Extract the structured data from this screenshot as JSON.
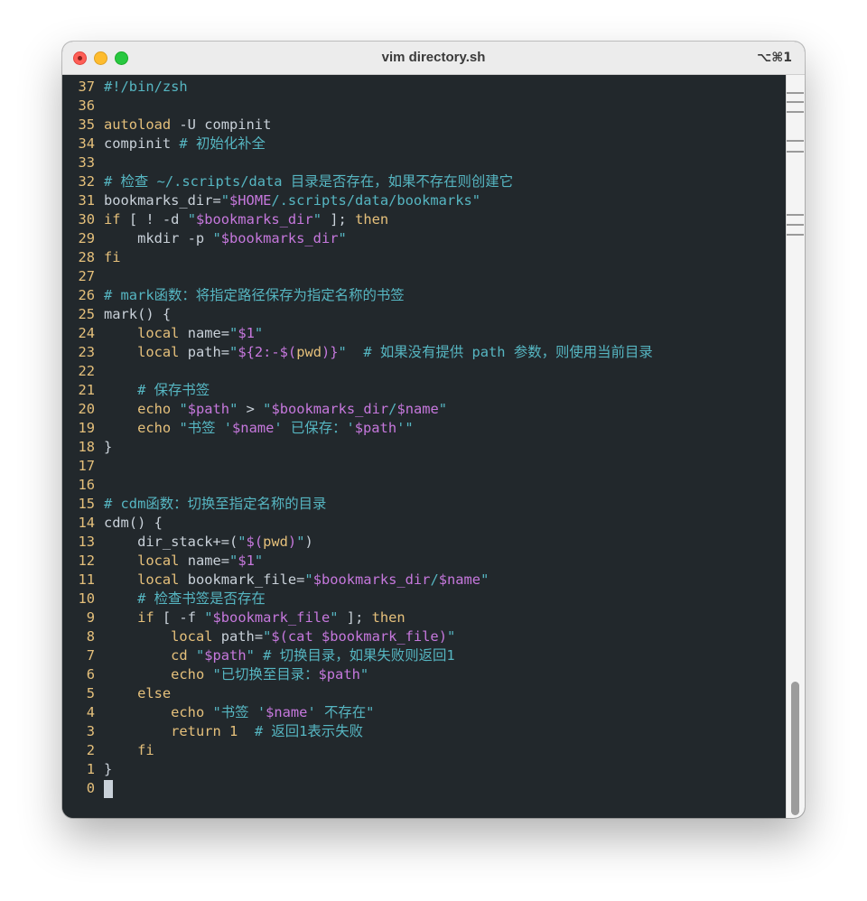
{
  "window": {
    "title": "vim directory.sh",
    "shortcut": "⌥⌘1"
  },
  "editor": {
    "lines": [
      {
        "n": "37",
        "t": [
          {
            "s": "#!/bin/zsh",
            "c": "cm"
          }
        ]
      },
      {
        "n": "36",
        "t": []
      },
      {
        "n": "35",
        "t": [
          {
            "s": "autoload",
            "c": "kw"
          },
          {
            "s": " -U compinit",
            "c": ""
          }
        ]
      },
      {
        "n": "34",
        "t": [
          {
            "s": "compinit ",
            "c": ""
          },
          {
            "s": "# 初始化补全",
            "c": "cm"
          }
        ]
      },
      {
        "n": "33",
        "t": []
      },
      {
        "n": "32",
        "t": [
          {
            "s": "# 检查 ~/.scripts/data 目录是否存在，如果不存在则创建它",
            "c": "cm"
          }
        ]
      },
      {
        "n": "31",
        "t": [
          {
            "s": "bookmarks_dir=",
            "c": ""
          },
          {
            "s": "\"",
            "c": "st"
          },
          {
            "s": "$HOME",
            "c": "vr"
          },
          {
            "s": "/.scripts/data/bookmarks\"",
            "c": "st"
          }
        ]
      },
      {
        "n": "30",
        "t": [
          {
            "s": "if",
            "c": "kw"
          },
          {
            "s": " [ ! -d ",
            "c": ""
          },
          {
            "s": "\"",
            "c": "st"
          },
          {
            "s": "$bookmarks_dir",
            "c": "vr"
          },
          {
            "s": "\"",
            "c": "st"
          },
          {
            "s": " ]; ",
            "c": ""
          },
          {
            "s": "then",
            "c": "kw"
          }
        ]
      },
      {
        "n": "29",
        "t": [
          {
            "s": "    mkdir -p ",
            "c": ""
          },
          {
            "s": "\"",
            "c": "st"
          },
          {
            "s": "$bookmarks_dir",
            "c": "vr"
          },
          {
            "s": "\"",
            "c": "st"
          }
        ]
      },
      {
        "n": "28",
        "t": [
          {
            "s": "fi",
            "c": "kw"
          }
        ]
      },
      {
        "n": "27",
        "t": []
      },
      {
        "n": "26",
        "t": [
          {
            "s": "# mark函数：将指定路径保存为指定名称的书签",
            "c": "cm"
          }
        ]
      },
      {
        "n": "25",
        "t": [
          {
            "s": "mark() {",
            "c": ""
          }
        ]
      },
      {
        "n": "24",
        "t": [
          {
            "s": "    ",
            "c": ""
          },
          {
            "s": "local",
            "c": "kw"
          },
          {
            "s": " name=",
            "c": ""
          },
          {
            "s": "\"",
            "c": "st"
          },
          {
            "s": "$1",
            "c": "vr"
          },
          {
            "s": "\"",
            "c": "st"
          }
        ]
      },
      {
        "n": "23",
        "t": [
          {
            "s": "    ",
            "c": ""
          },
          {
            "s": "local",
            "c": "kw"
          },
          {
            "s": " path=",
            "c": ""
          },
          {
            "s": "\"",
            "c": "st"
          },
          {
            "s": "${2:-$(",
            "c": "vr"
          },
          {
            "s": "pwd",
            "c": "cmd"
          },
          {
            "s": ")}",
            "c": "vr"
          },
          {
            "s": "\"",
            "c": "st"
          },
          {
            "s": "  # 如果没有提供 path 参数，则使用当前目录",
            "c": "cm"
          }
        ]
      },
      {
        "n": "22",
        "t": []
      },
      {
        "n": "21",
        "t": [
          {
            "s": "    # 保存书签",
            "c": "cm"
          }
        ]
      },
      {
        "n": "20",
        "t": [
          {
            "s": "    ",
            "c": ""
          },
          {
            "s": "echo",
            "c": "kw"
          },
          {
            "s": " ",
            "c": ""
          },
          {
            "s": "\"",
            "c": "st"
          },
          {
            "s": "$path",
            "c": "vr"
          },
          {
            "s": "\"",
            "c": "st"
          },
          {
            "s": " > ",
            "c": ""
          },
          {
            "s": "\"",
            "c": "st"
          },
          {
            "s": "$bookmarks_dir",
            "c": "vr"
          },
          {
            "s": "/",
            "c": "st"
          },
          {
            "s": "$name",
            "c": "vr"
          },
          {
            "s": "\"",
            "c": "st"
          }
        ]
      },
      {
        "n": "19",
        "t": [
          {
            "s": "    ",
            "c": ""
          },
          {
            "s": "echo",
            "c": "kw"
          },
          {
            "s": " ",
            "c": ""
          },
          {
            "s": "\"书签 '",
            "c": "st"
          },
          {
            "s": "$name",
            "c": "vr"
          },
          {
            "s": "' 已保存：'",
            "c": "st"
          },
          {
            "s": "$path",
            "c": "vr"
          },
          {
            "s": "'\"",
            "c": "st"
          }
        ]
      },
      {
        "n": "18",
        "t": [
          {
            "s": "}",
            "c": ""
          }
        ]
      },
      {
        "n": "17",
        "t": []
      },
      {
        "n": "16",
        "t": []
      },
      {
        "n": "15",
        "t": [
          {
            "s": "# cdm函数：切换至指定名称的目录",
            "c": "cm"
          }
        ]
      },
      {
        "n": "14",
        "t": [
          {
            "s": "cdm() {",
            "c": ""
          }
        ]
      },
      {
        "n": "13",
        "t": [
          {
            "s": "    dir_stack+=(",
            "c": ""
          },
          {
            "s": "\"",
            "c": "st"
          },
          {
            "s": "$(",
            "c": "vr"
          },
          {
            "s": "pwd",
            "c": "cmd"
          },
          {
            "s": ")",
            "c": "vr"
          },
          {
            "s": "\"",
            "c": "st"
          },
          {
            "s": ")",
            "c": ""
          }
        ]
      },
      {
        "n": "12",
        "t": [
          {
            "s": "    ",
            "c": ""
          },
          {
            "s": "local",
            "c": "kw"
          },
          {
            "s": " name=",
            "c": ""
          },
          {
            "s": "\"",
            "c": "st"
          },
          {
            "s": "$1",
            "c": "vr"
          },
          {
            "s": "\"",
            "c": "st"
          }
        ]
      },
      {
        "n": "11",
        "t": [
          {
            "s": "    ",
            "c": ""
          },
          {
            "s": "local",
            "c": "kw"
          },
          {
            "s": " bookmark_file=",
            "c": ""
          },
          {
            "s": "\"",
            "c": "st"
          },
          {
            "s": "$bookmarks_dir",
            "c": "vr"
          },
          {
            "s": "/",
            "c": "st"
          },
          {
            "s": "$name",
            "c": "vr"
          },
          {
            "s": "\"",
            "c": "st"
          }
        ]
      },
      {
        "n": "10",
        "t": [
          {
            "s": "    # 检查书签是否存在",
            "c": "cm"
          }
        ]
      },
      {
        "n": "9",
        "t": [
          {
            "s": "    ",
            "c": ""
          },
          {
            "s": "if",
            "c": "kw"
          },
          {
            "s": " [ -f ",
            "c": ""
          },
          {
            "s": "\"",
            "c": "st"
          },
          {
            "s": "$bookmark_file",
            "c": "vr"
          },
          {
            "s": "\"",
            "c": "st"
          },
          {
            "s": " ]; ",
            "c": ""
          },
          {
            "s": "then",
            "c": "kw"
          }
        ]
      },
      {
        "n": "8",
        "t": [
          {
            "s": "        ",
            "c": ""
          },
          {
            "s": "local",
            "c": "kw"
          },
          {
            "s": " path=",
            "c": ""
          },
          {
            "s": "\"",
            "c": "st"
          },
          {
            "s": "$(cat $bookmark_file)",
            "c": "vr"
          },
          {
            "s": "\"",
            "c": "st"
          }
        ]
      },
      {
        "n": "7",
        "t": [
          {
            "s": "        ",
            "c": ""
          },
          {
            "s": "cd",
            "c": "kw"
          },
          {
            "s": " ",
            "c": ""
          },
          {
            "s": "\"",
            "c": "st"
          },
          {
            "s": "$path",
            "c": "vr"
          },
          {
            "s": "\"",
            "c": "st"
          },
          {
            "s": " # 切换目录，如果失败则返回1",
            "c": "cm"
          }
        ]
      },
      {
        "n": "6",
        "t": [
          {
            "s": "        ",
            "c": ""
          },
          {
            "s": "echo",
            "c": "kw"
          },
          {
            "s": " ",
            "c": ""
          },
          {
            "s": "\"已切换至目录：",
            "c": "st"
          },
          {
            "s": "$path",
            "c": "vr"
          },
          {
            "s": "\"",
            "c": "st"
          }
        ]
      },
      {
        "n": "5",
        "t": [
          {
            "s": "    ",
            "c": ""
          },
          {
            "s": "else",
            "c": "kw"
          }
        ]
      },
      {
        "n": "4",
        "t": [
          {
            "s": "        ",
            "c": ""
          },
          {
            "s": "echo",
            "c": "kw"
          },
          {
            "s": " ",
            "c": ""
          },
          {
            "s": "\"书签 '",
            "c": "st"
          },
          {
            "s": "$name",
            "c": "vr"
          },
          {
            "s": "' 不存在\"",
            "c": "st"
          }
        ]
      },
      {
        "n": "3",
        "t": [
          {
            "s": "        ",
            "c": ""
          },
          {
            "s": "return",
            "c": "kw"
          },
          {
            "s": " 1",
            "c": "kw"
          },
          {
            "s": "  # 返回1表示失败",
            "c": "cm"
          }
        ]
      },
      {
        "n": "2",
        "t": [
          {
            "s": "    ",
            "c": ""
          },
          {
            "s": "fi",
            "c": "kw"
          }
        ]
      },
      {
        "n": "1",
        "t": [
          {
            "s": "}",
            "c": ""
          }
        ]
      },
      {
        "n": "0",
        "t": [],
        "cursor": true
      }
    ]
  },
  "colors": {
    "background": "#22282c",
    "line_number": "#e5c07b",
    "comment": "#56b6c2",
    "keyword": "#e5c07b",
    "string": "#56b6c2",
    "variable": "#c678dd",
    "text": "#c9d1d9"
  },
  "scrollbar": {
    "position": 0.84
  }
}
